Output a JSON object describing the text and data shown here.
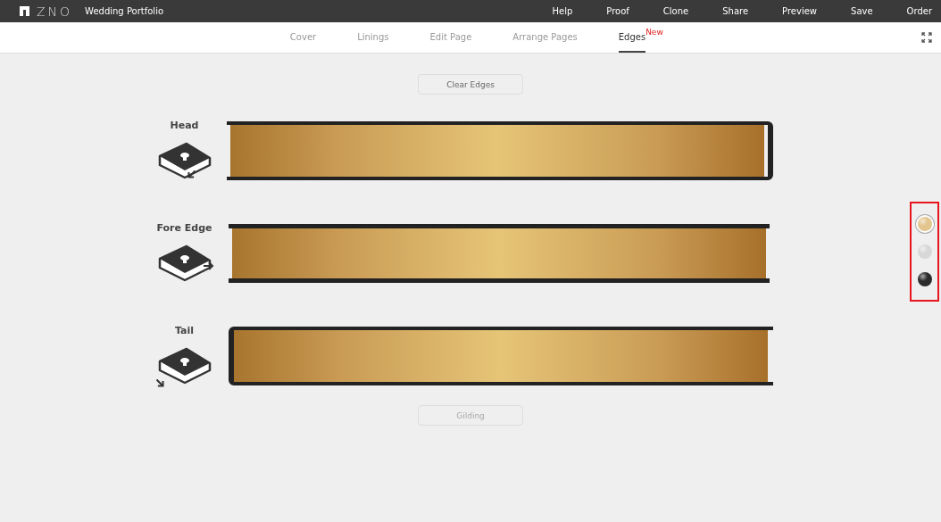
{
  "app": {
    "logo": "ZNO",
    "project_title": "Wedding Portfolio"
  },
  "top_menu": [
    {
      "label": "Help"
    },
    {
      "label": "Proof"
    },
    {
      "label": "Clone"
    },
    {
      "label": "Share"
    },
    {
      "label": "Preview"
    },
    {
      "label": "Save"
    },
    {
      "label": "Order"
    }
  ],
  "tabs": [
    {
      "label": "Cover",
      "selected": false
    },
    {
      "label": "Linings",
      "selected": false
    },
    {
      "label": "Edit Page",
      "selected": false
    },
    {
      "label": "Arrange Pages",
      "selected": false
    },
    {
      "label": "Edges",
      "selected": true,
      "badge": "New"
    }
  ],
  "clear_button": {
    "label": "Clear Edges",
    "disabled": false
  },
  "edges": [
    {
      "label": "Head",
      "kind": "head"
    },
    {
      "label": "Fore Edge",
      "kind": "fore"
    },
    {
      "label": "Tail",
      "kind": "tail"
    }
  ],
  "gilding_button": {
    "label": "Gilding",
    "disabled": true
  },
  "swatches": [
    {
      "color": "#e3c68e",
      "selected": true
    },
    {
      "color": "#d8d8d8",
      "selected": false
    },
    {
      "color": "#2c2c2c",
      "selected": false
    }
  ]
}
